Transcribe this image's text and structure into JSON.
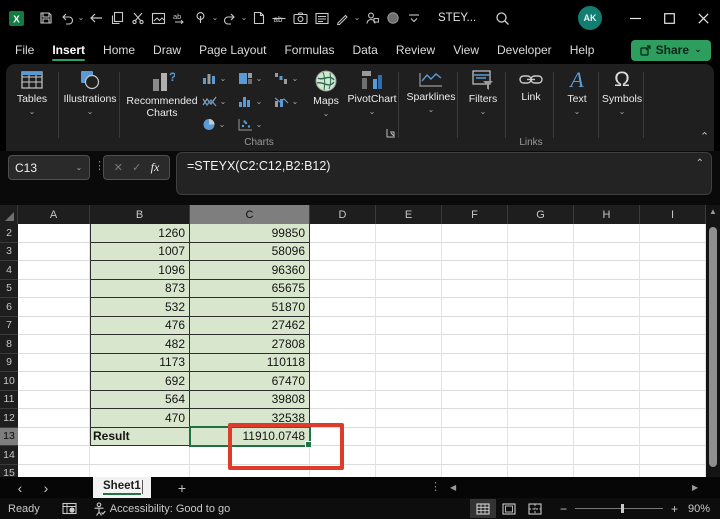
{
  "titlebar": {
    "doc_title": "STEY...",
    "avatar_initials": "AK"
  },
  "tabs": {
    "items": [
      "File",
      "Insert",
      "Home",
      "Draw",
      "Page Layout",
      "Formulas",
      "Data",
      "Review",
      "View",
      "Developer",
      "Help"
    ],
    "active": "Insert",
    "share_label": "Share"
  },
  "ribbon": {
    "tables": "Tables",
    "illustrations": "Illustrations",
    "recommended_charts": "Recommended\nCharts",
    "maps": "Maps",
    "pivotchart": "PivotChart",
    "sparklines": "Sparklines",
    "filters": "Filters",
    "link": "Link",
    "text": "Text",
    "symbols": "Symbols",
    "group_charts": "Charts",
    "group_links": "Links"
  },
  "formula_bar": {
    "name_box": "C13",
    "formula": "=STEYX(C2:C12,B2:B12)",
    "cancel_glyph": "✕",
    "enter_glyph": "✓",
    "fx_glyph": "fx"
  },
  "sheet": {
    "columns": [
      "A",
      "B",
      "C",
      "D",
      "E",
      "F",
      "G",
      "H",
      "I"
    ],
    "selected_column": "C",
    "selected_row": "13",
    "selected_cell": "C13",
    "rows": [
      {
        "num": "2",
        "b": "1260",
        "c": "99850"
      },
      {
        "num": "3",
        "b": "1007",
        "c": "58096"
      },
      {
        "num": "4",
        "b": "1096",
        "c": "96360"
      },
      {
        "num": "5",
        "b": "873",
        "c": "65675"
      },
      {
        "num": "6",
        "b": "532",
        "c": "51870"
      },
      {
        "num": "7",
        "b": "476",
        "c": "27462"
      },
      {
        "num": "8",
        "b": "482",
        "c": "27808"
      },
      {
        "num": "9",
        "b": "1173",
        "c": "110118"
      },
      {
        "num": "10",
        "b": "692",
        "c": "67470"
      },
      {
        "num": "11",
        "b": "564",
        "c": "39808"
      },
      {
        "num": "12",
        "b": "470",
        "c": "32538"
      },
      {
        "num": "13",
        "b": "Result",
        "c": "11910.0748"
      },
      {
        "num": "14",
        "b": "",
        "c": ""
      },
      {
        "num": "15",
        "b": "",
        "c": ""
      }
    ]
  },
  "sheet_bar": {
    "active_tab": "Sheet1",
    "add_sheet_glyph": "+",
    "nav_left_glyph": "‹",
    "nav_right_glyph": "›"
  },
  "status_bar": {
    "ready": "Ready",
    "accessibility": "Accessibility: Good to go",
    "zoom_level": "90%",
    "zoom_minus": "−",
    "zoom_plus": "+"
  },
  "glyphs": {
    "chevron_down": "⌄",
    "chevron_up": "⌃",
    "dots_vertical": "⋮",
    "up_triangle": "▲",
    "left_triangle": "◀",
    "right_triangle": "▶",
    "omega": "Ω",
    "text_a": "A"
  },
  "colors": {
    "accent_green": "#27a567",
    "selection_green": "#1e7145",
    "cell_fill_green": "#d9e6ce",
    "annotation_red": "#de3c2b",
    "share_green": "#2e9e5f",
    "avatar_teal": "#127e72"
  }
}
